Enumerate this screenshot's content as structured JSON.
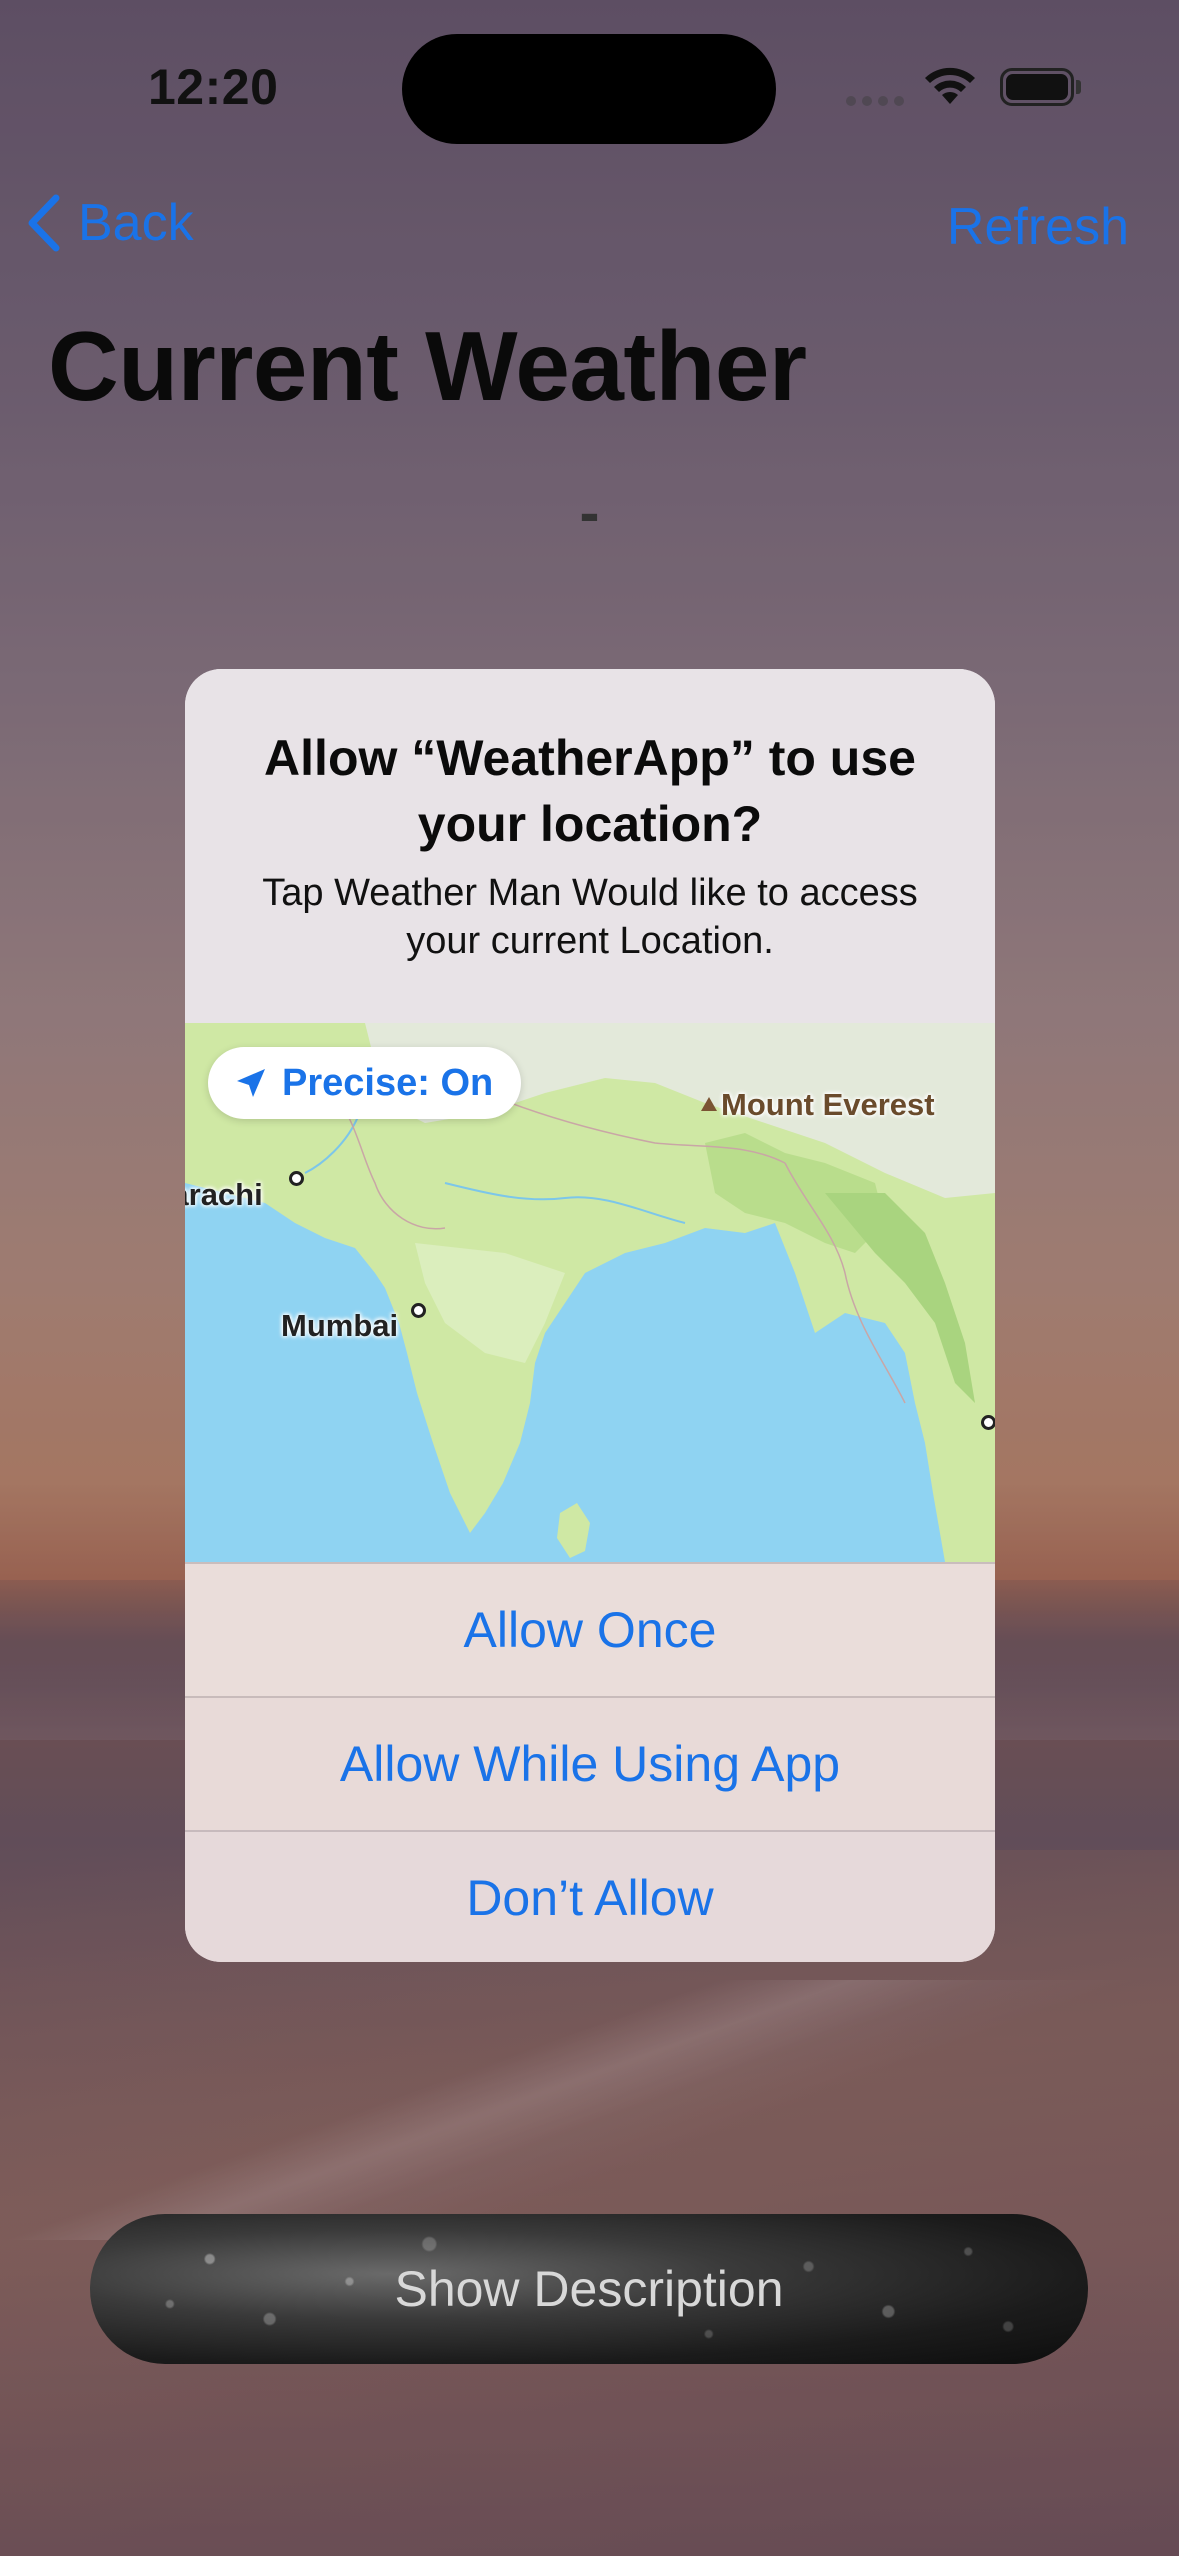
{
  "status_bar": {
    "time": "12:20"
  },
  "nav": {
    "back_label": "Back",
    "refresh_label": "Refresh"
  },
  "page": {
    "title": "Current Weather",
    "temperature_placeholder": "-"
  },
  "alert": {
    "title": "Allow “WeatherApp” to use your location?",
    "message": "Tap Weather Man Would like to access your current Location.",
    "precise_label": "Precise: On",
    "map_labels": {
      "karachi": "Karachi",
      "mumbai": "Mumbai",
      "everest": "Mount Everest"
    },
    "buttons": {
      "allow_once": "Allow Once",
      "allow_while_using": "Allow While Using App",
      "dont_allow": "Don’t Allow"
    }
  },
  "bottom": {
    "show_description_label": "Show Description"
  },
  "colors": {
    "accent": "#1a73e8",
    "title_text": "#0a0a0a",
    "map_water": "#8fd3f2",
    "map_land": "#cfe8a4"
  }
}
